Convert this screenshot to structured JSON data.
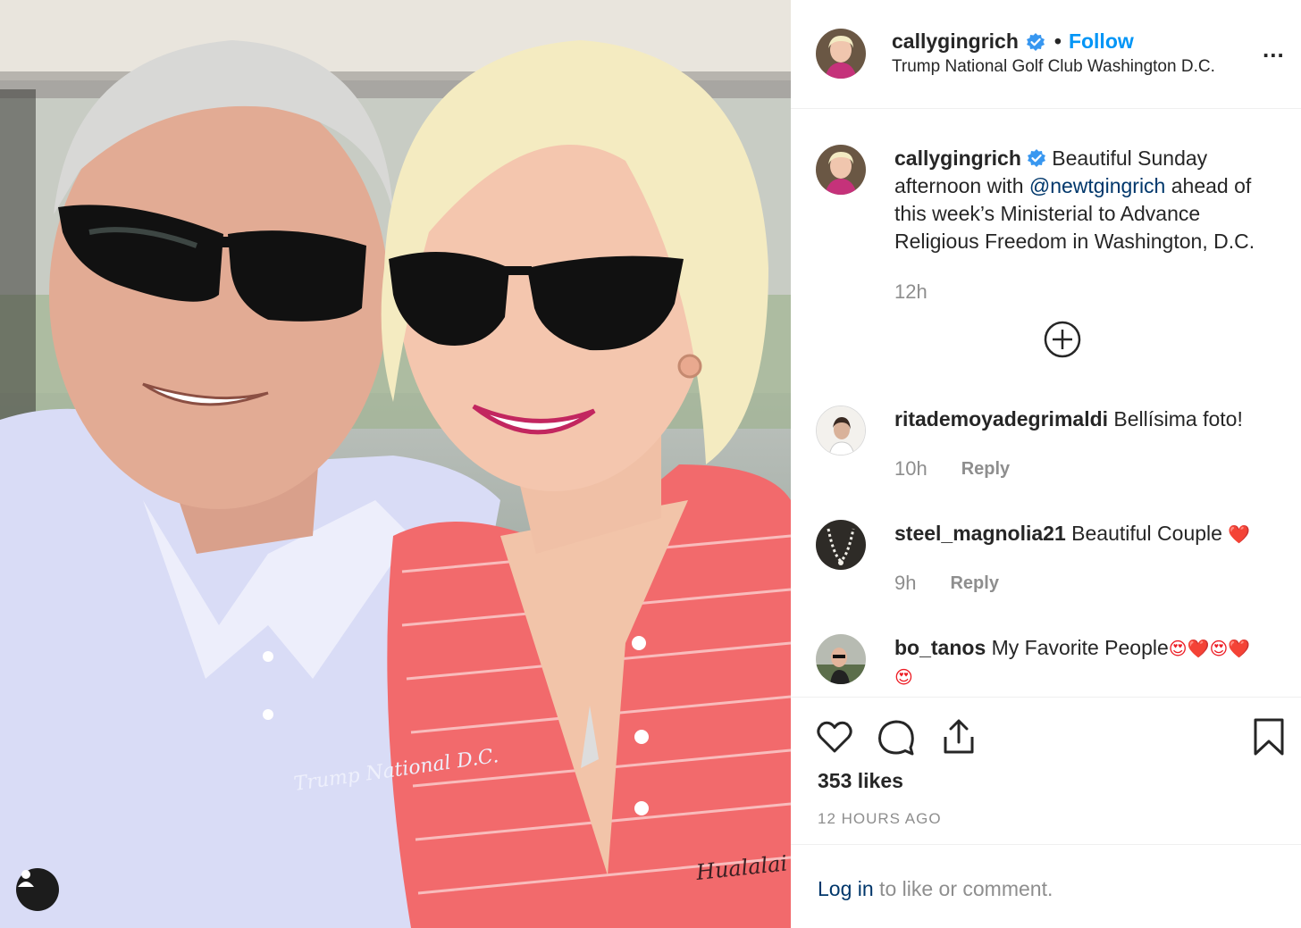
{
  "post": {
    "author": "callygingrich",
    "verified": true,
    "separator": "•",
    "follow_label": "Follow",
    "location": "Trump National Golf Club Washington D.C.",
    "more_label": "..."
  },
  "photo": {
    "shirt_text_left": "Trump National D.C.",
    "shirt_text_right": "Hualalai"
  },
  "caption": {
    "author": "callygingrich",
    "text_before": " Beautiful Sunday afternoon with ",
    "mention": "@newtgingrich",
    "text_after": " ahead of this week’s Ministerial to Advance Religious Freedom in Washington, D.C.",
    "time": "12h"
  },
  "comments": [
    {
      "author": "ritademoyadegrimaldi",
      "text": " Bellísima foto!",
      "time": "10h",
      "reply_label": "Reply"
    },
    {
      "author": "steel_magnolia21",
      "text": " Beautiful Couple ",
      "emoji": "❤️",
      "time": "9h",
      "reply_label": "Reply"
    },
    {
      "author": "bo_tanos",
      "text": " My Favorite People",
      "emoji": "😍❤️😍❤️",
      "emoji_wrap": "😍"
    }
  ],
  "actions": {
    "likes": "353 likes",
    "time_ago": "12 HOURS AGO"
  },
  "login": {
    "link": "Log in",
    "text": " to like or comment."
  },
  "colors": {
    "link_blue": "#0095f6",
    "mention_blue": "#00376b",
    "muted": "#8e8e8e",
    "text": "#262626",
    "shirt_pink": "#f26a6c",
    "shirt_lavender": "#d9dcf6"
  },
  "icons": [
    "verified-badge-icon",
    "more-options-icon",
    "load-more-comments-icon",
    "like-icon",
    "comment-icon",
    "share-icon",
    "save-icon",
    "tagged-user-icon"
  ]
}
